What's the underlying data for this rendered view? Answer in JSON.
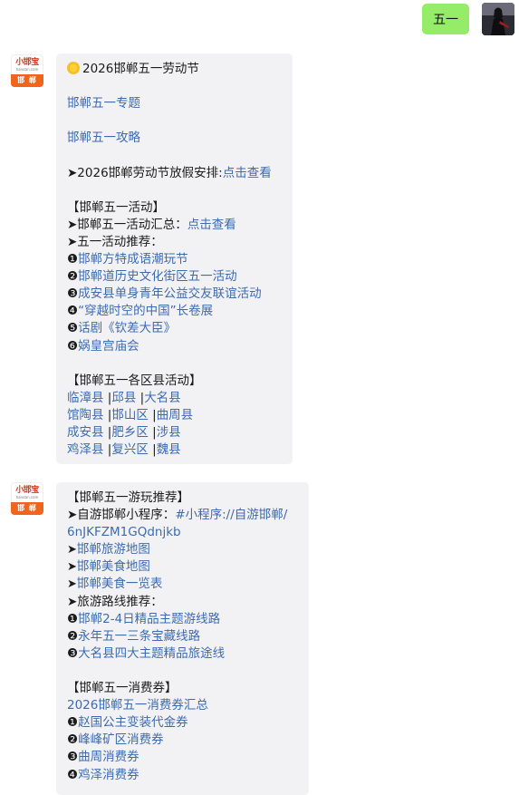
{
  "user": {
    "message": "五一"
  },
  "bot_logo": {
    "top": "小邯宝",
    "mid": "handan.com",
    "bar": "邯 郸"
  },
  "bubble1": {
    "title": "2026邯郸五一劳动节",
    "link_topic": "邯郸五一专题",
    "link_guide": "邯郸五一攻略",
    "holiday_prefix": "➤2026邯郸劳动节放假安排:",
    "holiday_link": "点击查看",
    "activity_header": "【邯郸五一活动】",
    "activity_summary_prefix": "➤邯郸五一活动汇总：",
    "activity_summary_link": "点击查看",
    "activity_recommend": "➤五一活动推荐：",
    "activities": [
      {
        "num": "❶",
        "label": "邯郸方特成语潮玩节"
      },
      {
        "num": "❷",
        "label": "邯郸道历史文化街区五一活动"
      },
      {
        "num": "❸",
        "label": "成安县单身青年公益交友联谊活动"
      },
      {
        "num": "❹",
        "label": "“穿越时空的中国”长卷展"
      },
      {
        "num": "❺",
        "label": "话剧《钦差大臣》"
      },
      {
        "num": "❻",
        "label": "娲皇宫庙会"
      }
    ],
    "district_header": "【邯郸五一各区县活动】",
    "districts": [
      [
        "临漳县",
        "邱县",
        "大名县"
      ],
      [
        "馆陶县",
        "邯山区",
        "曲周县"
      ],
      [
        "成安县",
        "肥乡区",
        "涉县"
      ],
      [
        "鸡泽县",
        "复兴区",
        "魏县"
      ]
    ]
  },
  "bubble2": {
    "travel_header": "【邯郸五一游玩推荐】",
    "miniprogram_prefix": "➤自游邯郸小程序：",
    "miniprogram_link_1": "#小程序://自游邯郸/",
    "miniprogram_link_2": "6nJKFZM1GQdnjkb",
    "map_travel": "邯郸旅游地图",
    "map_food": "邯郸美食地图",
    "food_list": "邯郸美食一览表",
    "route_header": "➤旅游路线推荐：",
    "routes": [
      {
        "num": "❶",
        "label": "邯郸2-4日精品主题游线路"
      },
      {
        "num": "❷",
        "label": "永年五一三条宝藏线路"
      },
      {
        "num": "❸",
        "label": "大名县四大主题精品旅途线"
      }
    ],
    "coupon_header": "【邯郸五一消费券】",
    "coupon_summary": "2026邯郸五一消费券汇总",
    "coupons": [
      {
        "num": "❶",
        "label": "赵国公主变装代金券"
      },
      {
        "num": "❷",
        "label": "峰峰矿区消费券"
      },
      {
        "num": "❸",
        "label": "曲周消费券"
      },
      {
        "num": "❹",
        "label": "鸡泽消费券"
      }
    ]
  }
}
